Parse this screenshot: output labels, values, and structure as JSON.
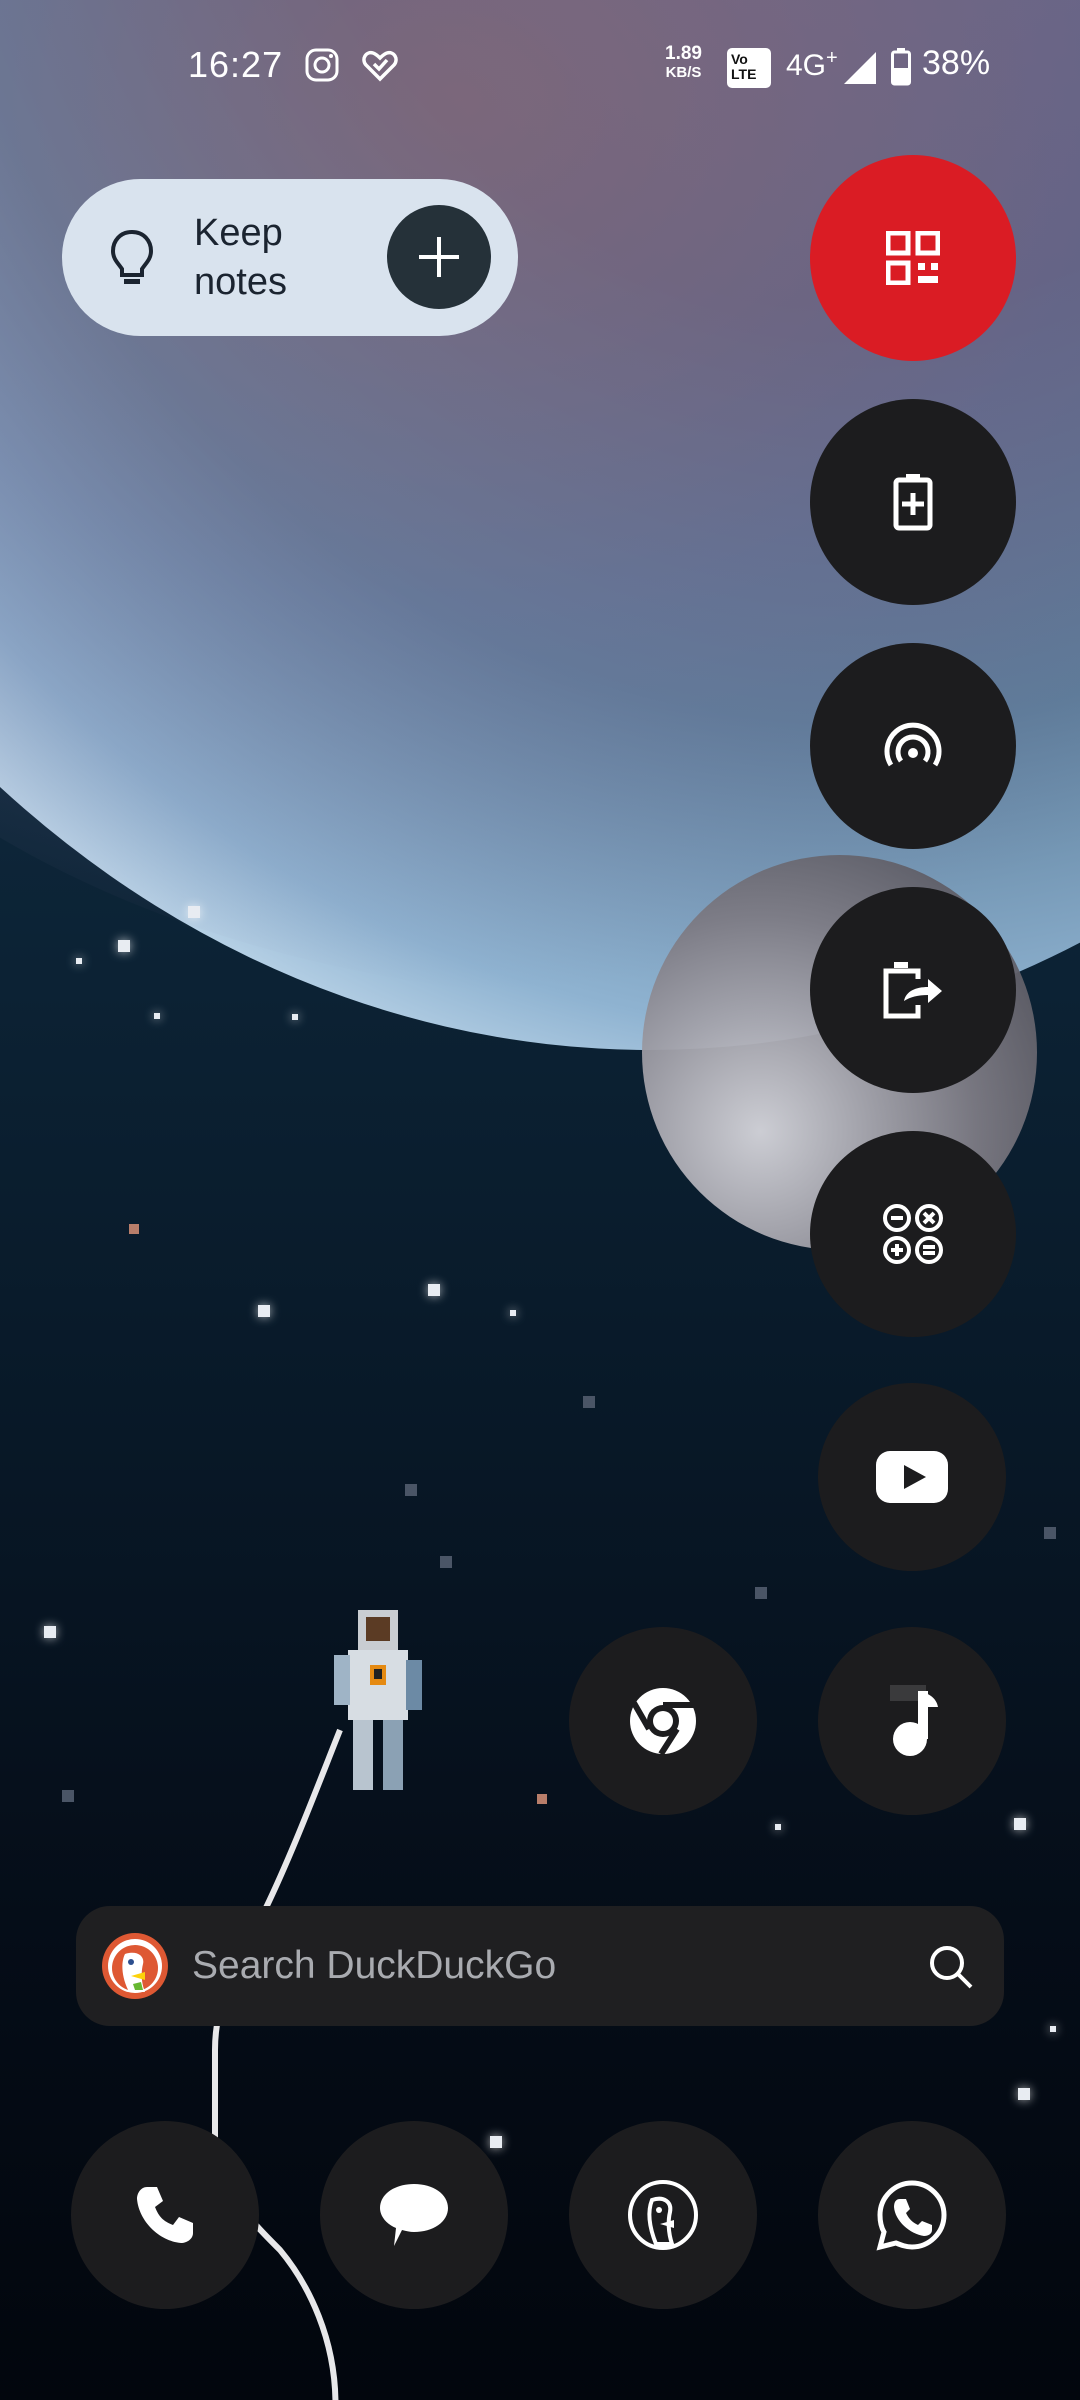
{
  "status_bar": {
    "time": "16:27",
    "left_icons": [
      "instagram-icon",
      "heart-check-icon"
    ],
    "speed_value": "1.89",
    "speed_unit": "KB/S",
    "volte_top": "Vo",
    "volte_bottom": "LTE",
    "network": "4G",
    "network_sup": "+",
    "battery": "38%"
  },
  "keep_widget": {
    "label_line1": "Keep",
    "label_line2": "notes",
    "icon": "lightbulb-icon",
    "add_icon": "plus-icon"
  },
  "shortcuts": [
    {
      "icon": "qr-scan-icon",
      "color": "#da1c24"
    },
    {
      "icon": "battery-saver-icon"
    },
    {
      "icon": "hotspot-icon"
    },
    {
      "icon": "screen-cast-icon"
    },
    {
      "icon": "calculator-icon"
    }
  ],
  "apps": [
    {
      "icon": "youtube-icon"
    },
    {
      "icon": "chrome-icon"
    },
    {
      "icon": "music-icon"
    }
  ],
  "search": {
    "placeholder": "Search DuckDuckGo",
    "logo": "duckduckgo-logo-icon",
    "icon": "search-icon"
  },
  "dock": [
    {
      "icon": "phone-icon"
    },
    {
      "icon": "messages-icon"
    },
    {
      "icon": "duckduckgo-icon"
    },
    {
      "icon": "whatsapp-icon"
    }
  ],
  "colors": {
    "accent_red": "#da1c24",
    "widget_bg": "#d9e3ee",
    "button_bg": "#1c1c1e"
  }
}
